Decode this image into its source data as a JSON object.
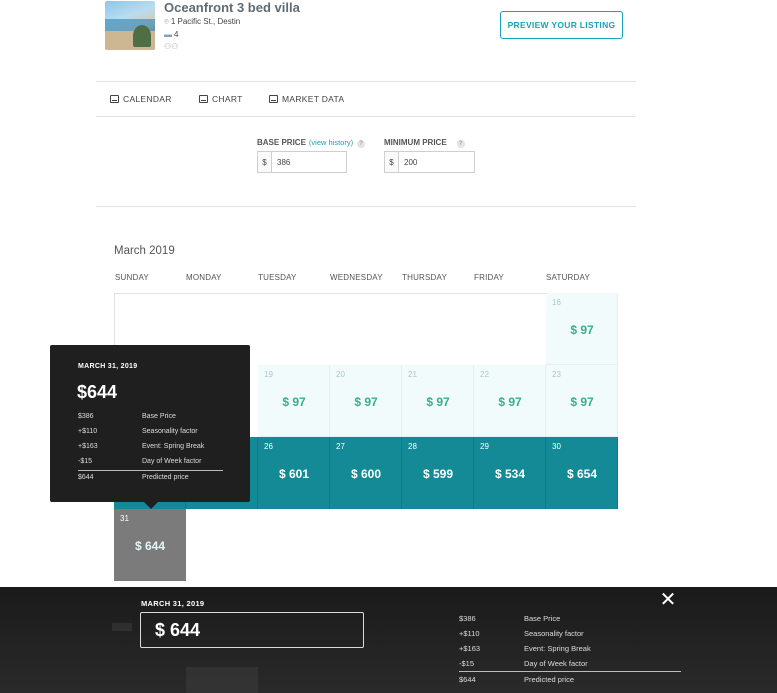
{
  "listing": {
    "title": "Oceanfront 3 bed villa",
    "address": "1 Pacific St., Destin",
    "beds": "4",
    "preview_label": "PREVIEW YOUR LISTING"
  },
  "tabs": {
    "calendar": "CALENDAR",
    "chart": "CHART",
    "market": "MARKET DATA"
  },
  "prices": {
    "base_label": "BASE PRICE",
    "view_history": "(view history)",
    "base_currency": "$",
    "base_value": "386",
    "min_label": "MINIMUM PRICE",
    "min_currency": "$",
    "min_value": "200",
    "help": "?"
  },
  "calendar": {
    "month": "March 2019",
    "weekdays": [
      "SUNDAY",
      "MONDAY",
      "TUESDAY",
      "WEDNESDAY",
      "THURSDAY",
      "FRIDAY",
      "SATURDAY"
    ],
    "days": [
      {
        "day": "16",
        "price": "$ 97"
      },
      {
        "day": "19",
        "price": "$ 97"
      },
      {
        "day": "20",
        "price": "$ 97"
      },
      {
        "day": "21",
        "price": "$ 97"
      },
      {
        "day": "22",
        "price": "$ 97"
      },
      {
        "day": "23",
        "price": "$ 97"
      },
      {
        "day": "26",
        "price": "$ 601"
      },
      {
        "day": "27",
        "price": "$ 600"
      },
      {
        "day": "28",
        "price": "$ 599"
      },
      {
        "day": "29",
        "price": "$ 534"
      },
      {
        "day": "30",
        "price": "$ 654"
      },
      {
        "day": "31",
        "price": "$ 644"
      }
    ]
  },
  "tooltip": {
    "date": "MARCH 31, 2019",
    "price": "$644",
    "rows": [
      {
        "amount": "$386",
        "label": "Base Price"
      },
      {
        "amount": "+$110",
        "label": "Seasonality factor"
      },
      {
        "amount": "+$163",
        "label": "Event: Spring Break"
      },
      {
        "amount": "-$15",
        "label": "Day of Week factor"
      },
      {
        "amount": "$644",
        "label": "Predicted price"
      }
    ]
  },
  "bottom": {
    "date": "MARCH 31, 2019",
    "price": "$ 644",
    "close": "✕",
    "rows": [
      {
        "amount": "$386",
        "label": "Base Price"
      },
      {
        "amount": "+$110",
        "label": "Seasonality factor"
      },
      {
        "amount": "+$163",
        "label": "Event: Spring Break"
      },
      {
        "amount": "-$15",
        "label": "Day of Week factor"
      },
      {
        "amount": "$644",
        "label": "Predicted price"
      }
    ]
  },
  "colors": {
    "accent": "#17a2b8",
    "cell_dark": "#138a95",
    "price_green": "#33b08c"
  }
}
